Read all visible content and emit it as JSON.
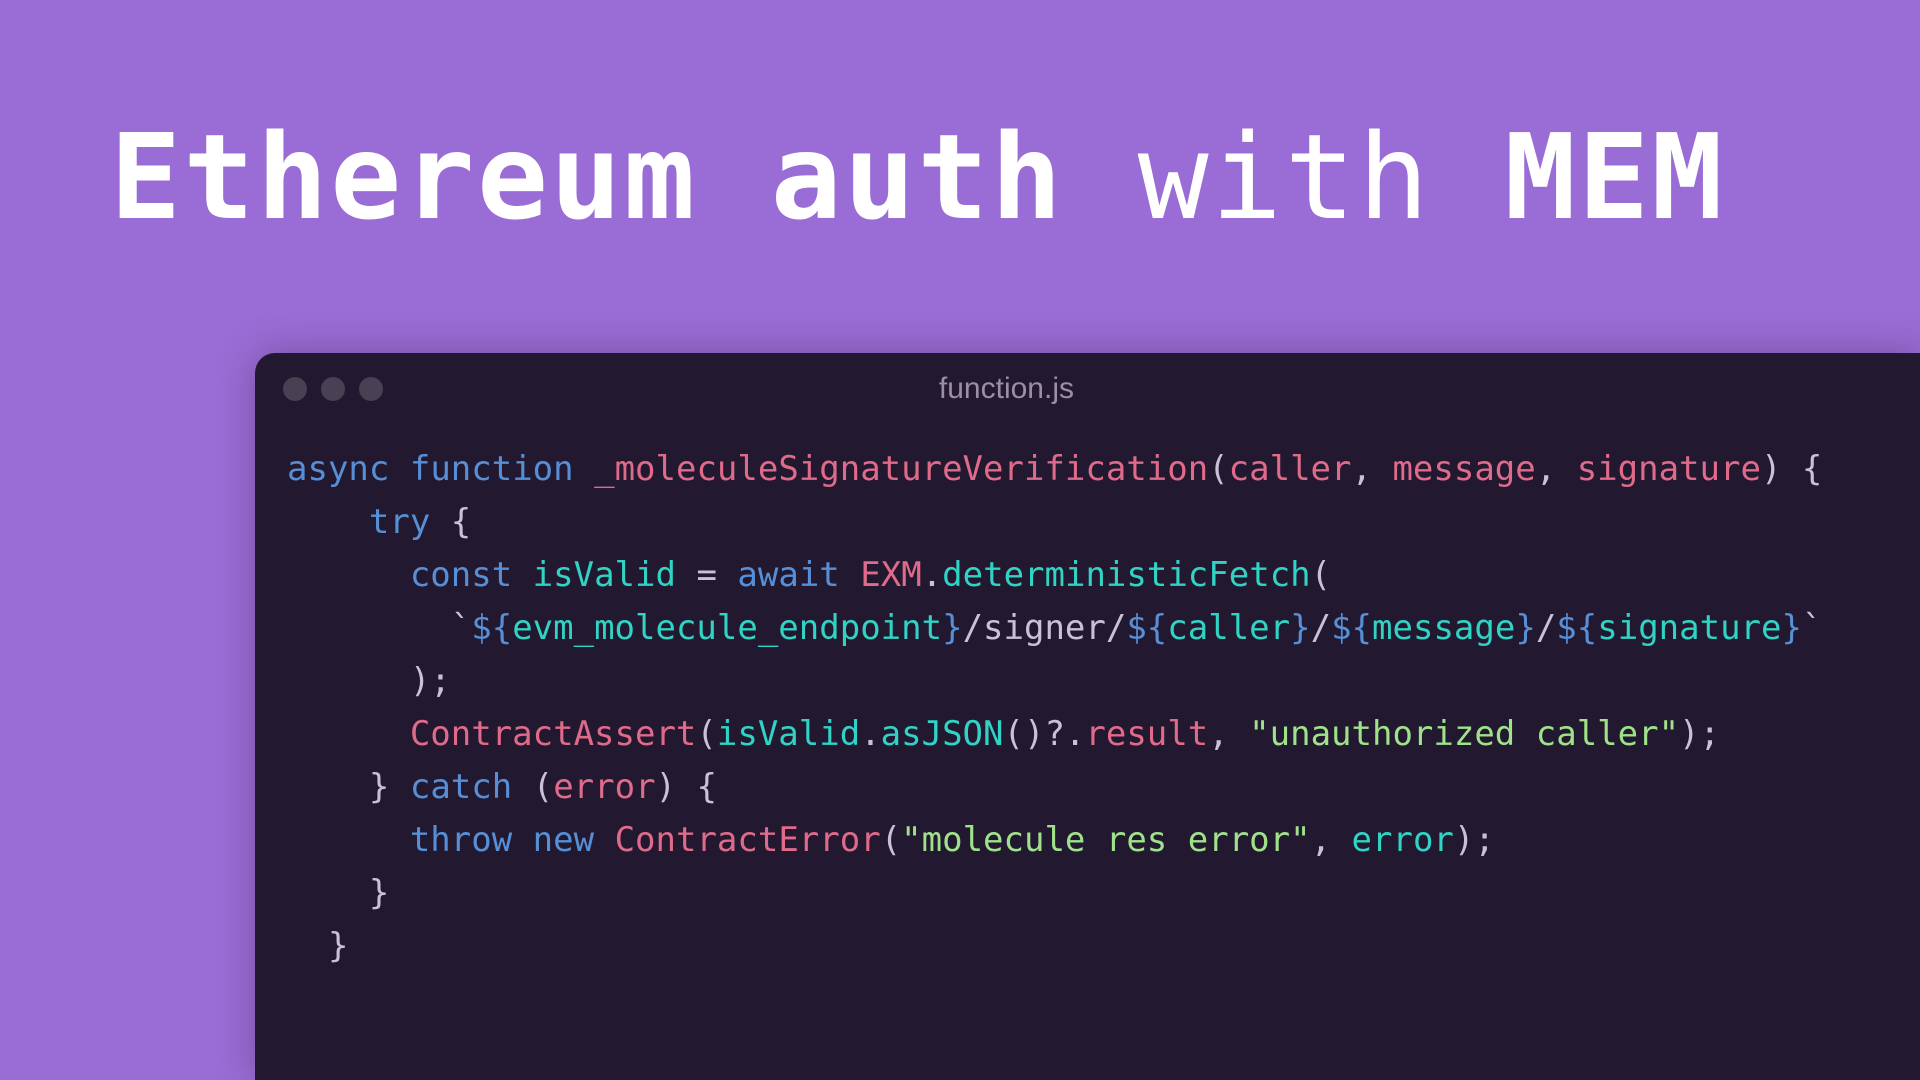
{
  "title": {
    "part1": "Ethereum auth",
    "part2": "with",
    "part3": "MEM"
  },
  "editor": {
    "filename": "function.js",
    "code": {
      "l1": {
        "async": "async",
        "function": "function",
        "name": "_moleculeSignatureVerification",
        "p1": "caller",
        "p2": "message",
        "p3": "signature"
      },
      "l2": {
        "try": "try"
      },
      "l3": {
        "const": "const",
        "ident": "isValid",
        "eq": "=",
        "await": "await",
        "exm": "EXM",
        "method": "deterministicFetch"
      },
      "l4": {
        "tick1": "`",
        "d1": "${",
        "v1": "evm_molecule_endpoint",
        "d1c": "}",
        "s1": "/signer/",
        "d2": "${",
        "v2": "caller",
        "d2c": "}",
        "s2": "/",
        "d3": "${",
        "v3": "message",
        "d3c": "}",
        "s3": "/",
        "d4": "${",
        "v4": "signature",
        "d4c": "}",
        "tick2": "`"
      },
      "l5": {
        "close": ");"
      },
      "l6": {
        "ca": "ContractAssert",
        "isv": "isValid",
        "asj": "asJSON",
        "opt": "()?.",
        "res": "result",
        "str": "\"unauthorized caller\""
      },
      "l7": {
        "catch": "catch",
        "err": "error"
      },
      "l8": {
        "throw": "throw",
        "new": "new",
        "ce": "ContractError",
        "str": "\"molecule res error\"",
        "err": "error"
      },
      "l9": {
        "brace": "}"
      },
      "l10": {
        "brace": "}"
      }
    }
  }
}
